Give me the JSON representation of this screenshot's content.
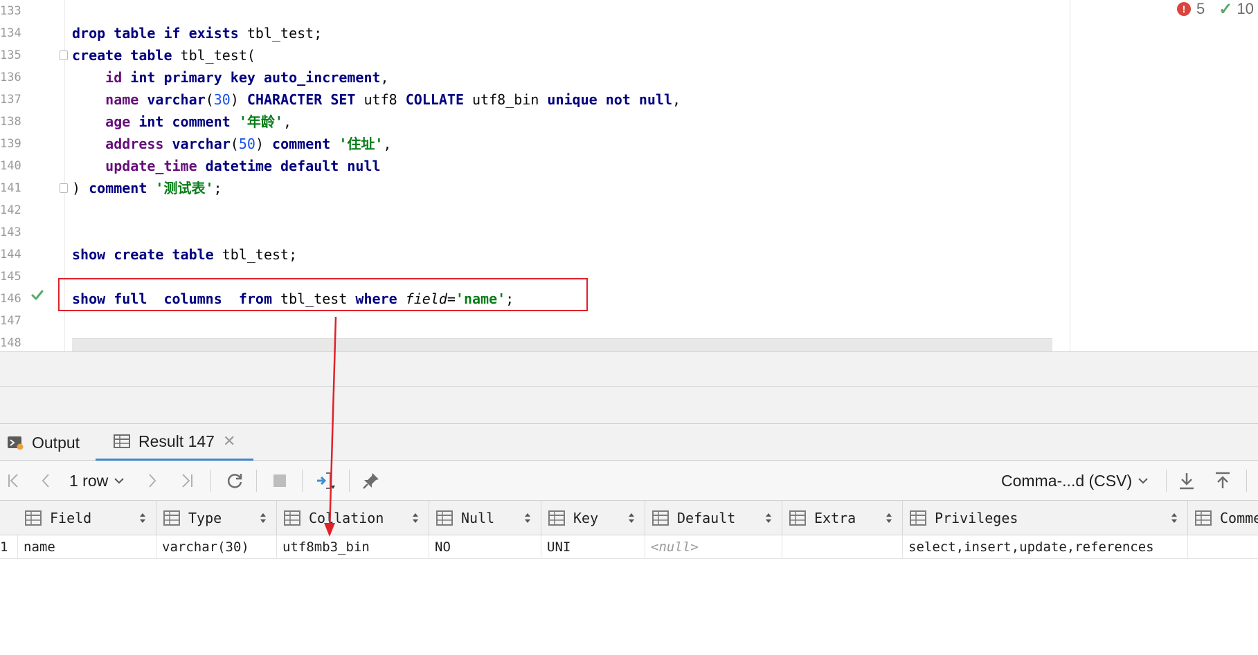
{
  "editor": {
    "line_numbers": [
      "133",
      "134",
      "135",
      "136",
      "137",
      "138",
      "139",
      "140",
      "141",
      "142",
      "143",
      "144",
      "145",
      "146",
      "147",
      "148"
    ],
    "inspections": {
      "errors": "5",
      "ok": "10"
    },
    "lines": [
      [],
      [
        [
          "kw",
          "drop table if exists "
        ],
        [
          "plain",
          "tbl_test;"
        ]
      ],
      [
        [
          "kw",
          "create table "
        ],
        [
          "plain",
          "tbl_test("
        ]
      ],
      [
        [
          "plain",
          "    "
        ],
        [
          "col",
          "id "
        ],
        [
          "kw",
          "int primary key auto_increment"
        ],
        [
          "plain",
          ","
        ]
      ],
      [
        [
          "plain",
          "    "
        ],
        [
          "col",
          "name "
        ],
        [
          "kw",
          "varchar"
        ],
        [
          "plain",
          "("
        ],
        [
          "num",
          "30"
        ],
        [
          "plain",
          ") "
        ],
        [
          "kw",
          "CHARACTER SET "
        ],
        [
          "plain",
          "utf8 "
        ],
        [
          "kw",
          "COLLATE "
        ],
        [
          "plain",
          "utf8_bin "
        ],
        [
          "kw",
          "unique not null"
        ],
        [
          "plain",
          ","
        ]
      ],
      [
        [
          "plain",
          "    "
        ],
        [
          "col",
          "age "
        ],
        [
          "kw",
          "int comment "
        ],
        [
          "str",
          "'年龄'"
        ],
        [
          "plain",
          ","
        ]
      ],
      [
        [
          "plain",
          "    "
        ],
        [
          "col",
          "address "
        ],
        [
          "kw",
          "varchar"
        ],
        [
          "plain",
          "("
        ],
        [
          "num",
          "50"
        ],
        [
          "plain",
          ") "
        ],
        [
          "kw",
          "comment "
        ],
        [
          "str",
          "'住址'"
        ],
        [
          "plain",
          ","
        ]
      ],
      [
        [
          "plain",
          "    "
        ],
        [
          "col",
          "update_time "
        ],
        [
          "kw",
          "datetime default null"
        ]
      ],
      [
        [
          "plain",
          ") "
        ],
        [
          "kw",
          "comment "
        ],
        [
          "str",
          "'测试表'"
        ],
        [
          "plain",
          ";"
        ]
      ],
      [],
      [],
      [
        [
          "kw",
          "show create table "
        ],
        [
          "plain",
          "tbl_test;"
        ]
      ],
      [],
      [
        [
          "kw",
          "show full  columns  from "
        ],
        [
          "plain",
          "tbl_test "
        ],
        [
          "kw",
          "where "
        ],
        [
          "fld",
          "field"
        ],
        [
          "plain",
          "="
        ],
        [
          "str",
          "'name'"
        ],
        [
          "plain",
          ";"
        ]
      ],
      [],
      []
    ]
  },
  "tabs": {
    "output_label": "Output",
    "result_label": "Result 147",
    "close_glyph": "✕"
  },
  "toolbar": {
    "rows_label": "1 row",
    "export_format": "Comma-...d (CSV)"
  },
  "grid": {
    "columns": [
      "Field",
      "Type",
      "Collation",
      "Null",
      "Key",
      "Default",
      "Extra",
      "Privileges",
      "Comment"
    ],
    "row_number": "1",
    "row": [
      "name",
      "varchar(30)",
      "utf8mb3_bin",
      "NO",
      "UNI",
      "<null>",
      "",
      "select,insert,update,references",
      ""
    ]
  },
  "colors": {
    "keyword": "#000080",
    "column": "#660e7a",
    "string": "#067d17",
    "number": "#1750eb",
    "highlight_box": "#e0212a",
    "active_tab": "#4083c9"
  }
}
